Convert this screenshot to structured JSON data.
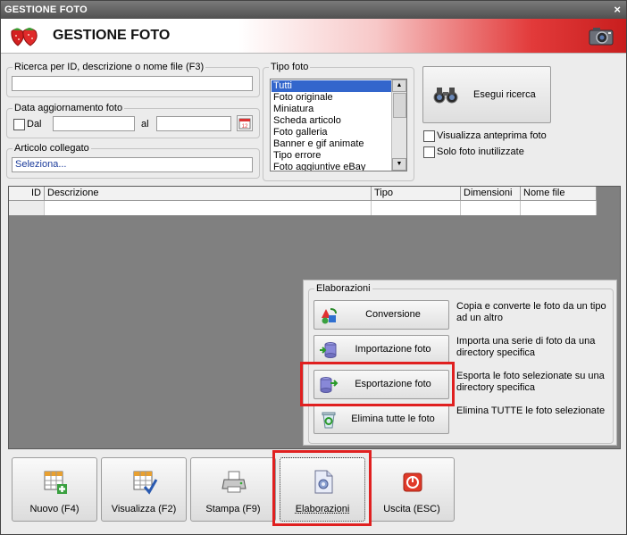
{
  "window": {
    "title": "GESTIONE FOTO",
    "close_glyph": "×"
  },
  "header": {
    "title": "GESTIONE FOTO",
    "logo_icon": "strawberry-logo-icon",
    "camera_icon": "camera-icon"
  },
  "search": {
    "legend": "Ricerca per ID, descrizione o nome file (F3)",
    "value": ""
  },
  "date_filter": {
    "legend": "Data aggiornamento foto",
    "from_label": "Dal",
    "to_label": "al",
    "from_value": "",
    "to_value": "",
    "calendar_icon": "calendar-icon",
    "calendar_day": "12"
  },
  "linked_article": {
    "legend": "Articolo collegato",
    "value": "Seleziona..."
  },
  "photo_type": {
    "legend": "Tipo foto",
    "options": [
      "Tutti",
      "Foto originale",
      "Miniatura",
      "Scheda articolo",
      "Foto galleria",
      "Banner e gif animate",
      "Tipo errore",
      "Foto aggiuntive eBay"
    ],
    "selected_index": 0
  },
  "search_button": {
    "label": "Esegui ricerca",
    "icon": "binoculars-icon"
  },
  "options": {
    "preview_label": "Visualizza anteprima foto",
    "unused_label": "Solo foto inutilizzate"
  },
  "grid": {
    "columns": [
      "ID",
      "Descrizione",
      "Tipo",
      "Dimensioni",
      "Nome file"
    ]
  },
  "elaborations": {
    "legend": "Elaborazioni",
    "items": [
      {
        "label": "Conversione",
        "description": "Copia e converte le foto da un tipo ad un altro",
        "icon": "convert-icon"
      },
      {
        "label": "Importazione foto",
        "description": "Importa una serie di foto da una directory specifica",
        "icon": "import-icon"
      },
      {
        "label": "Esportazione foto",
        "description": "Esporta le foto selezionate su una directory specifica",
        "icon": "export-icon"
      },
      {
        "label": "Elimina tutte le foto",
        "description": "Elimina TUTTE le foto selezionate",
        "icon": "recycle-bin-icon"
      }
    ]
  },
  "bottom_buttons": [
    {
      "label": "Nuovo (F4)",
      "icon": "new-grid-icon"
    },
    {
      "label": "Visualizza (F2)",
      "icon": "view-check-icon"
    },
    {
      "label": "Stampa (F9)",
      "icon": "printer-icon"
    },
    {
      "label": "Elaborazioni",
      "icon": "process-icon"
    },
    {
      "label": "Uscita (ESC)",
      "icon": "exit-icon"
    }
  ],
  "colors": {
    "highlight": "#e02020",
    "selection": "#3366cc",
    "header_red": "#c81e1e"
  }
}
